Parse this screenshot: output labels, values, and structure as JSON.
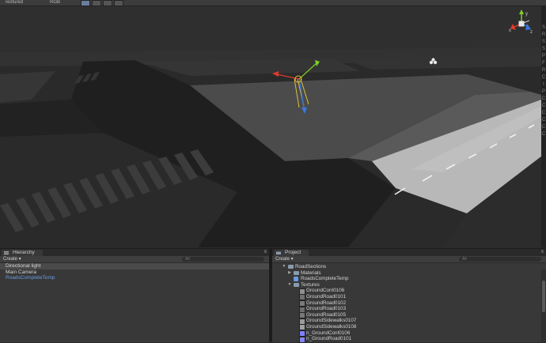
{
  "toolbar": {
    "shading_mode": "Textured",
    "render_mode": "RGB",
    "buttons": [
      "toggle-2d",
      "toggle-lighting",
      "toggle-audio",
      "toggle-effects"
    ]
  },
  "gizmo": {
    "x_label": "x",
    "y_label": "y",
    "z_label": "z"
  },
  "right_gutter_glyphs": [
    "S",
    "R",
    "S",
    "S",
    "P",
    "F",
    "R",
    "C",
    "I",
    "P",
    "C",
    "C",
    "C",
    "C",
    "C",
    "C"
  ],
  "hierarchy": {
    "tab_label": "Hierarchy",
    "create_label": "Create",
    "search_placeholder": "All",
    "items": [
      {
        "label": "Directional light",
        "selected": true,
        "prefab": false
      },
      {
        "label": "Main Camera",
        "selected": false,
        "prefab": false
      },
      {
        "label": "RoadsCompleteTemp",
        "selected": false,
        "prefab": true
      }
    ]
  },
  "project": {
    "tab_label": "Project",
    "create_label": "Create",
    "search_placeholder": "All",
    "items": [
      {
        "label": "RoadSections",
        "kind": "folder",
        "depth": 0,
        "expanded": true
      },
      {
        "label": "Materials",
        "kind": "folder",
        "depth": 1,
        "expanded": false
      },
      {
        "label": "RoadsCompleteTemp",
        "kind": "prefab",
        "depth": 1,
        "expanded": false
      },
      {
        "label": "Textures",
        "kind": "folder",
        "depth": 1,
        "expanded": true
      },
      {
        "label": "GroundConI0106",
        "kind": "texture",
        "depth": 2,
        "color": "#8e8e8e"
      },
      {
        "label": "GroundRoad0101",
        "kind": "texture",
        "depth": 2,
        "color": "#707070"
      },
      {
        "label": "GroundRoad0102",
        "kind": "texture",
        "depth": 2,
        "color": "#7a7a7a"
      },
      {
        "label": "GroundRoad0103",
        "kind": "texture",
        "depth": 2,
        "color": "#6e6e6e"
      },
      {
        "label": "GroundRoad0105",
        "kind": "texture",
        "depth": 2,
        "color": "#777777"
      },
      {
        "label": "GroundSidewalks0107",
        "kind": "texture",
        "depth": 2,
        "color": "#9a9a9a"
      },
      {
        "label": "GroundSidewalks0108",
        "kind": "texture",
        "depth": 2,
        "color": "#a0a0a0"
      },
      {
        "label": "n_GroundConI0106",
        "kind": "texture",
        "depth": 2,
        "color": "#8080ff"
      },
      {
        "label": "n_GroundRoad0101",
        "kind": "texture",
        "depth": 2,
        "color": "#8585f5"
      }
    ]
  },
  "colors": {
    "selection": "#4a4a4a",
    "prefab_text": "#6a9ae0",
    "gizmo_x": "#e03a2a",
    "gizmo_y": "#7ed321",
    "gizmo_z": "#3a78e0"
  }
}
